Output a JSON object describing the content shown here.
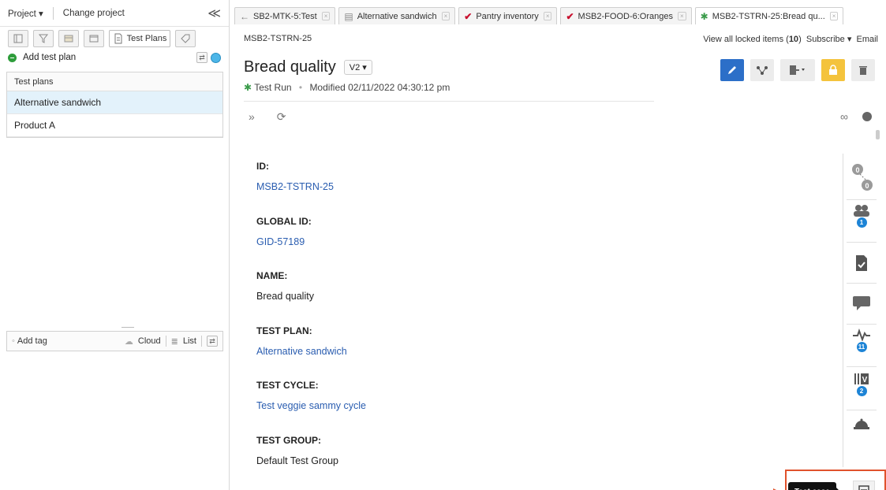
{
  "left_panel": {
    "project_label": "Project ▾",
    "change_project": "Change project",
    "collapse": "≪",
    "active_tab": "Test Plans",
    "add_plan": "Add test plan",
    "list_header": "Test plans",
    "plans": [
      "Alternative sandwich",
      "Product A"
    ],
    "tag_bar": {
      "add_tag": "Add tag",
      "cloud": "Cloud",
      "list": "List"
    }
  },
  "tabs": [
    {
      "label": "SB2-MTK-5:Test",
      "icon": "back-arrow"
    },
    {
      "label": "Alternative sandwich",
      "icon": "document-icon"
    },
    {
      "label": "Pantry inventory",
      "icon": "check-icon"
    },
    {
      "label": "MSB2-FOOD-6:Oranges",
      "icon": "check-icon"
    },
    {
      "label": "MSB2-TSTRN-25:Bread qu...",
      "icon": "runner-icon"
    }
  ],
  "header": {
    "item_id": "MSB2-TSTRN-25",
    "locked_prefix": "View all locked items (",
    "locked_count": "10",
    "locked_suffix": ")",
    "subscribe": "Subscribe ▾",
    "email": "Email",
    "title": "Bread quality",
    "version": "V2 ▾",
    "item_type": "Test Run",
    "modified": "Modified 02/11/2022 04:30:12 pm"
  },
  "fields": [
    {
      "label": "ID:",
      "value": "MSB2-TSTRN-25",
      "link": true
    },
    {
      "label": "GLOBAL ID:",
      "value": "GID-57189",
      "link": true
    },
    {
      "label": "NAME:",
      "value": "Bread quality",
      "link": false
    },
    {
      "label": "TEST PLAN:",
      "value": "Alternative sandwich",
      "link": true
    },
    {
      "label": "TEST CYCLE:",
      "value": "Test veggie sammy cycle",
      "link": true
    },
    {
      "label": "TEST GROUP:",
      "value": "Default Test Group",
      "link": false
    }
  ],
  "rail_badges": {
    "relationships_top": "0",
    "relationships_bottom": "0",
    "users": "1",
    "activity": "11",
    "versions": "2"
  },
  "tooltip": "Test case",
  "colors": {
    "accent": "#2c6fc8",
    "link": "#2a5db0",
    "annotation": "#e0522c",
    "lock": "#f4c33c"
  }
}
